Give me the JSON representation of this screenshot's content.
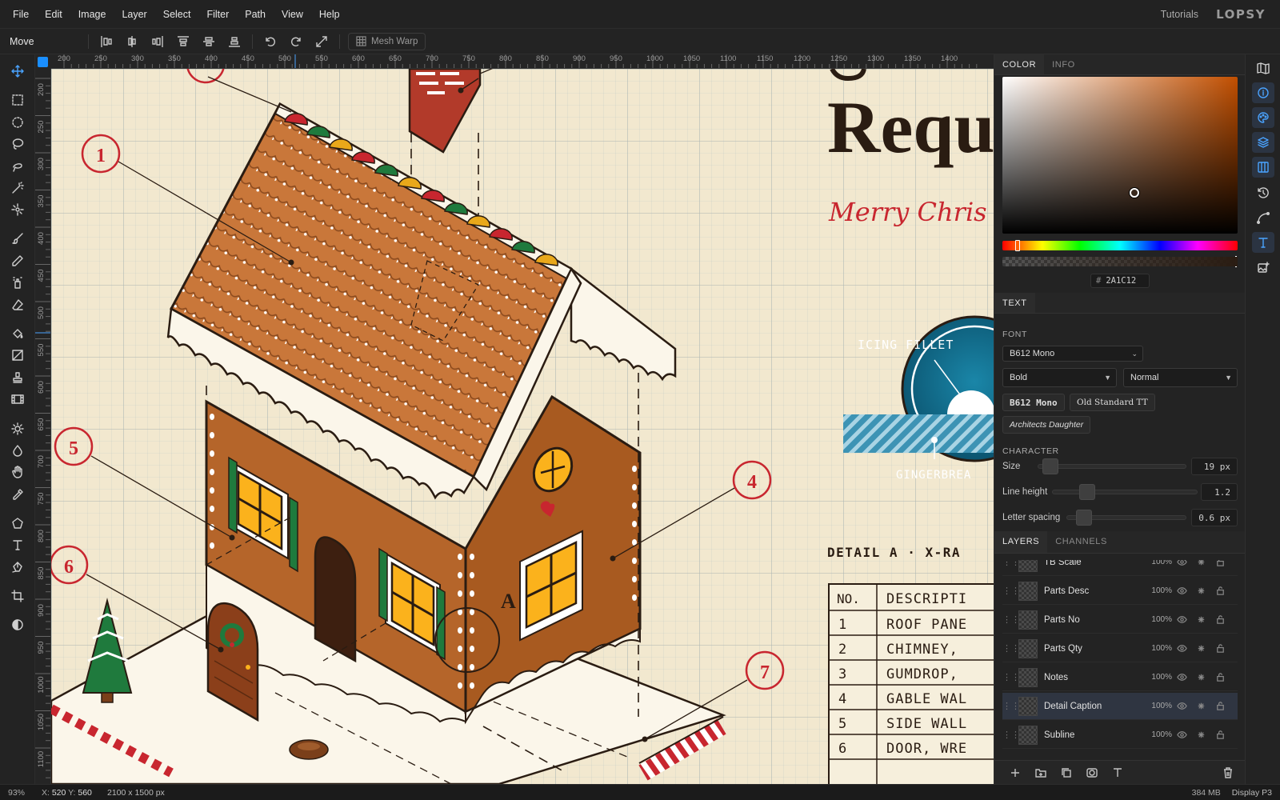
{
  "menu": {
    "items": [
      "File",
      "Edit",
      "Image",
      "Layer",
      "Select",
      "Filter",
      "Path",
      "View",
      "Help"
    ],
    "tutorials": "Tutorials",
    "logo": "LOPSY"
  },
  "toolbar": {
    "tool_name": "Move",
    "mesh_warp": "Mesh Warp"
  },
  "rulers": {
    "h_ticks": [
      "200",
      "250",
      "300",
      "350",
      "400",
      "450",
      "500",
      "550",
      "600",
      "650",
      "700",
      "750",
      "800",
      "850",
      "900",
      "950",
      "1000",
      "1050",
      "1100",
      "1150",
      "1200",
      "1250",
      "1300",
      "1350",
      "1400"
    ],
    "v_ticks": [
      "200",
      "250",
      "300",
      "350",
      "400",
      "450",
      "500",
      "550",
      "600",
      "650",
      "700",
      "750",
      "800",
      "850",
      "900",
      "950",
      "1000",
      "1050",
      "1100"
    ]
  },
  "artwork": {
    "title_partial": "Requ",
    "subtitle_partial": "Merry Chris",
    "callouts": [
      "1",
      "5",
      "6",
      "4",
      "7"
    ],
    "gable_letter": "A",
    "seal": {
      "top": "ICING FILLET",
      "bottom": "GINGERBREA"
    },
    "detail_heading": "DETAIL A · X-RA",
    "table": {
      "headers": [
        "NO.",
        "DESCRIPTI"
      ],
      "rows": [
        [
          "1",
          "ROOF PANE"
        ],
        [
          "2",
          "CHIMNEY,"
        ],
        [
          "3",
          "GUMDROP,"
        ],
        [
          "4",
          "GABLE WAL"
        ],
        [
          "5",
          "SIDE WALL"
        ],
        [
          "6",
          "DOOR, WRE"
        ]
      ]
    }
  },
  "panel": {
    "color_tabs": [
      "COLOR",
      "INFO"
    ],
    "hex_prefix": "#",
    "hex_value": "2A1C12",
    "text_tab": "TEXT",
    "font_label": "FONT",
    "font_family": "B612 Mono",
    "font_weight": "Bold",
    "font_style": "Normal",
    "font_chips": [
      "B612 Mono",
      "Old Standard TT",
      "Architects Daughter"
    ],
    "character_label": "CHARACTER",
    "size_label": "Size",
    "size_value": "19 px",
    "line_height_label": "Line height",
    "line_height_value": "1.2",
    "letter_spacing_label": "Letter spacing",
    "letter_spacing_value": "0.6 px",
    "layer_tabs": [
      "LAYERS",
      "CHANNELS"
    ],
    "layers": [
      {
        "name": "TB Scale",
        "opacity": "100%"
      },
      {
        "name": "Parts Desc",
        "opacity": "100%"
      },
      {
        "name": "Parts No",
        "opacity": "100%"
      },
      {
        "name": "Parts Qty",
        "opacity": "100%"
      },
      {
        "name": "Notes",
        "opacity": "100%"
      },
      {
        "name": "Detail Caption",
        "opacity": "100%"
      },
      {
        "name": "Subline",
        "opacity": "100%"
      }
    ]
  },
  "status": {
    "zoom": "93%",
    "x_label": "X:",
    "x": "520",
    "y_label": "Y:",
    "y": "560",
    "doc_size": "2100 x 1500 px",
    "memory": "384 MB",
    "profile": "Display P3"
  },
  "colors": {
    "accent": "#4aa3ff",
    "paper": "#f2e8cf",
    "gingerbread": "#b5652a",
    "callout_red": "#c8262f",
    "seal_blue": "#0b5c7a"
  }
}
